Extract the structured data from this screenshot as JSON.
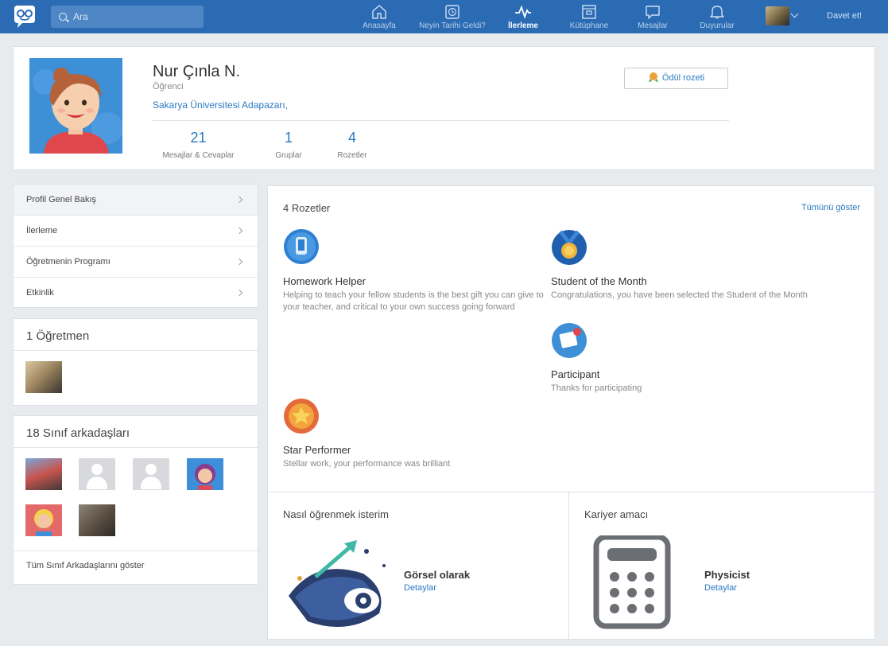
{
  "topbar": {
    "search_placeholder": "Ara",
    "nav": [
      {
        "label": "Anasayfa",
        "icon": "home-icon"
      },
      {
        "label": "Neyin Tarihi Geldi?",
        "icon": "alarm-clock-icon"
      },
      {
        "label": "İlerleme",
        "icon": "pulse-icon",
        "active": true
      },
      {
        "label": "Kütüphane",
        "icon": "library-icon"
      },
      {
        "label": "Mesajlar",
        "icon": "chat-bubble-icon"
      },
      {
        "label": "Duyurular",
        "icon": "bell-icon"
      }
    ],
    "invite_label": "Davet et!",
    "accent_color": "#2a6bb4"
  },
  "profile": {
    "name": "Nur Çınla N.",
    "role": "Öğrenci",
    "school": "Sakarya Üniversitesi Adapazarı,",
    "award_button": "Ödül rozeti",
    "stats": [
      {
        "value": "21",
        "label": "Mesajlar & Cevaplar"
      },
      {
        "value": "1",
        "label": "Gruplar"
      },
      {
        "value": "4",
        "label": "Rozetler"
      }
    ]
  },
  "menu": {
    "items": [
      {
        "label": "Profil Genel Bakış",
        "active": true
      },
      {
        "label": "İlerleme"
      },
      {
        "label": "Öğretmenin Programı"
      },
      {
        "label": "Etkinlik"
      }
    ]
  },
  "teachers": {
    "title": "1 Öğretmen"
  },
  "classmates": {
    "title": "18 Sınıf arkadaşları",
    "show_all": "Tüm Sınıf Arkadaşlarını göster"
  },
  "badges": {
    "title": "4 Rozetler",
    "show_all": "Tümünü göster",
    "items": [
      {
        "name": "Homework Helper",
        "desc": "Helping to teach your fellow students is the best gift you can give to your teacher, and critical to your own success going forward",
        "icon": "homework-helper-badge-icon"
      },
      {
        "name": "Student of the Month",
        "desc": "Congratulations, you have been selected the Student of the Month",
        "icon": "medal-badge-icon"
      },
      {
        "name": "Participant",
        "desc": "Thanks for participating",
        "icon": "participant-badge-icon"
      },
      {
        "name": "Star Performer",
        "desc": "Stellar work, your performance was brilliant",
        "icon": "star-badge-icon"
      }
    ]
  },
  "learning": {
    "title": "Nasıl öğrenmek isterim",
    "style": "Görsel olarak",
    "details": "Detaylar"
  },
  "career": {
    "title": "Kariyer amacı",
    "goal": "Physicist",
    "details": "Detaylar"
  }
}
